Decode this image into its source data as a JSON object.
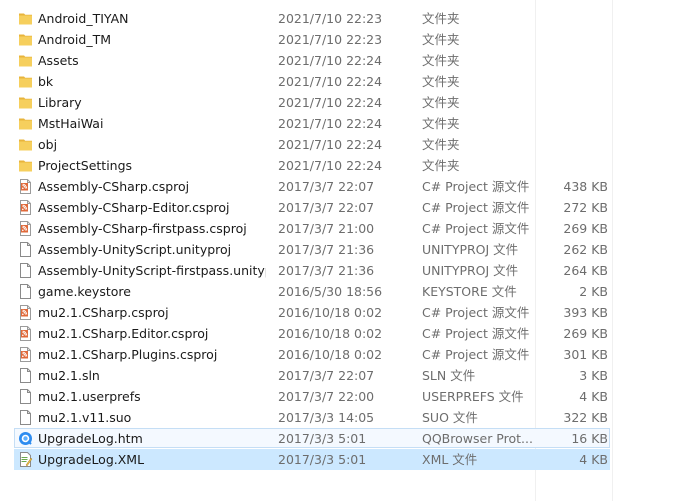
{
  "files": [
    {
      "name": "Android_TIYAN",
      "date": "2021/7/10 22:23",
      "type": "文件夹",
      "size": "",
      "icon": "folder-icon"
    },
    {
      "name": "Android_TM",
      "date": "2021/7/10 22:23",
      "type": "文件夹",
      "size": "",
      "icon": "folder-icon"
    },
    {
      "name": "Assets",
      "date": "2021/7/10 22:24",
      "type": "文件夹",
      "size": "",
      "icon": "folder-icon"
    },
    {
      "name": "bk",
      "date": "2021/7/10 22:24",
      "type": "文件夹",
      "size": "",
      "icon": "folder-icon"
    },
    {
      "name": "Library",
      "date": "2021/7/10 22:24",
      "type": "文件夹",
      "size": "",
      "icon": "folder-icon"
    },
    {
      "name": "MstHaiWai",
      "date": "2021/7/10 22:24",
      "type": "文件夹",
      "size": "",
      "icon": "folder-icon"
    },
    {
      "name": "obj",
      "date": "2021/7/10 22:24",
      "type": "文件夹",
      "size": "",
      "icon": "folder-icon"
    },
    {
      "name": "ProjectSettings",
      "date": "2021/7/10 22:24",
      "type": "文件夹",
      "size": "",
      "icon": "folder-icon"
    },
    {
      "name": "Assembly-CSharp.csproj",
      "date": "2017/3/7 22:07",
      "type": "C# Project 源文件",
      "size": "438 KB",
      "icon": "csproj-icon"
    },
    {
      "name": "Assembly-CSharp-Editor.csproj",
      "date": "2017/3/7 22:07",
      "type": "C# Project 源文件",
      "size": "272 KB",
      "icon": "csproj-icon"
    },
    {
      "name": "Assembly-CSharp-firstpass.csproj",
      "date": "2017/3/7 21:00",
      "type": "C# Project 源文件",
      "size": "269 KB",
      "icon": "csproj-icon"
    },
    {
      "name": "Assembly-UnityScript.unityproj",
      "date": "2017/3/7 21:36",
      "type": "UNITYPROJ 文件",
      "size": "262 KB",
      "icon": "blank-file-icon"
    },
    {
      "name": "Assembly-UnityScript-firstpass.unityp...",
      "date": "2017/3/7 21:36",
      "type": "UNITYPROJ 文件",
      "size": "264 KB",
      "icon": "blank-file-icon"
    },
    {
      "name": "game.keystore",
      "date": "2016/5/30 18:56",
      "type": "KEYSTORE 文件",
      "size": "2 KB",
      "icon": "blank-file-icon"
    },
    {
      "name": "mu2.1.CSharp.csproj",
      "date": "2016/10/18 0:02",
      "type": "C# Project 源文件",
      "size": "393 KB",
      "icon": "csproj-icon"
    },
    {
      "name": "mu2.1.CSharp.Editor.csproj",
      "date": "2016/10/18 0:02",
      "type": "C# Project 源文件",
      "size": "269 KB",
      "icon": "csproj-icon"
    },
    {
      "name": "mu2.1.CSharp.Plugins.csproj",
      "date": "2016/10/18 0:02",
      "type": "C# Project 源文件",
      "size": "301 KB",
      "icon": "csproj-icon"
    },
    {
      "name": "mu2.1.sln",
      "date": "2017/3/7 22:07",
      "type": "SLN 文件",
      "size": "3 KB",
      "icon": "blank-file-icon"
    },
    {
      "name": "mu2.1.userprefs",
      "date": "2017/3/7 22:00",
      "type": "USERPREFS 文件",
      "size": "4 KB",
      "icon": "blank-file-icon"
    },
    {
      "name": "mu2.1.v11.suo",
      "date": "2017/3/3 14:05",
      "type": "SUO 文件",
      "size": "322 KB",
      "icon": "blank-file-icon"
    },
    {
      "name": "UpgradeLog.htm",
      "date": "2017/3/3 5:01",
      "type": "QQBrowser Prot...",
      "size": "16 KB",
      "icon": "qqbrowser-icon",
      "state": "hover"
    },
    {
      "name": "UpgradeLog.XML",
      "date": "2017/3/3 5:01",
      "type": "XML 文件",
      "size": "4 KB",
      "icon": "xml-file-icon",
      "state": "selected"
    }
  ]
}
